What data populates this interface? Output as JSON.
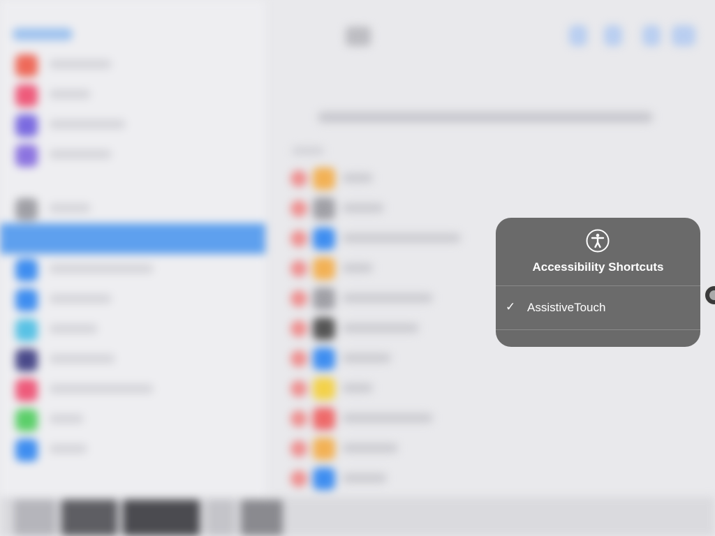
{
  "popup": {
    "title": "Accessibility Shortcuts",
    "icon": "accessibility-icon",
    "options": [
      {
        "label": "AssistiveTouch",
        "checked": true
      }
    ]
  },
  "colors": {
    "popup_bg": "#5c5c5c",
    "selected_row": "#5ea0ee",
    "minus_red": "#ee8f8f"
  }
}
